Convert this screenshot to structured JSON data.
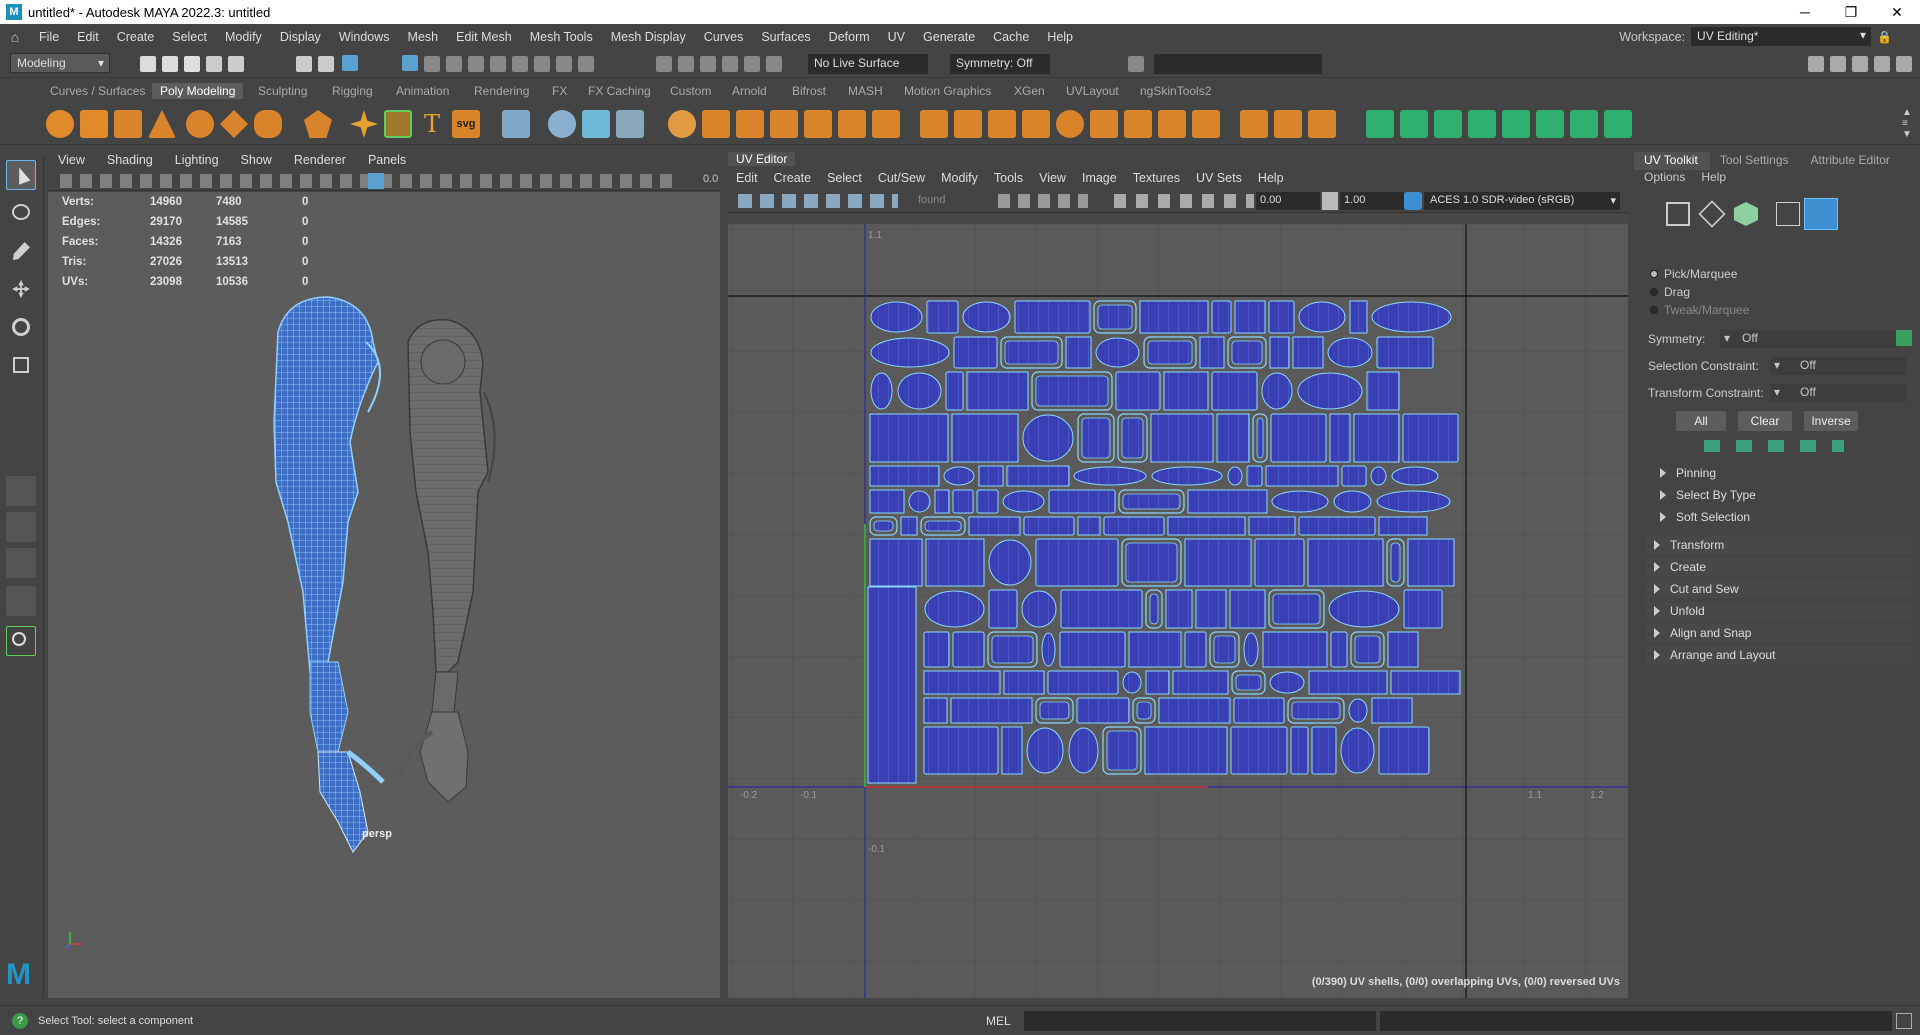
{
  "window": {
    "title": "untitled* - Autodesk MAYA 2022.3: untitled",
    "controls": [
      "─",
      "❐",
      "✕"
    ]
  },
  "menubar": {
    "items": [
      "File",
      "Edit",
      "Create",
      "Select",
      "Modify",
      "Display",
      "Windows",
      "Mesh",
      "Edit Mesh",
      "Mesh Tools",
      "Mesh Display",
      "Curves",
      "Surfaces",
      "Deform",
      "UV",
      "Generate",
      "Cache",
      "Help"
    ],
    "workspace_label": "Workspace:",
    "workspace_value": "UV Editing*"
  },
  "statusline": {
    "mode": "Modeling",
    "live_surface": "No Live Surface",
    "symmetry": "Symmetry: Off"
  },
  "shelf": {
    "tabs": [
      "Curves / Surfaces",
      "Poly Modeling",
      "Sculpting",
      "Rigging",
      "Animation",
      "Rendering",
      "FX",
      "FX Caching",
      "Custom",
      "Arnold",
      "Bifrost",
      "MASH",
      "Motion Graphics",
      "XGen",
      "UVLayout",
      "ngSkinTools2"
    ],
    "active_tab": "Poly Modeling",
    "svg_label": "svg"
  },
  "viewport": {
    "menu": [
      "View",
      "Shading",
      "Lighting",
      "Show",
      "Renderer",
      "Panels"
    ],
    "camera": "persp",
    "hud_value": "0.0",
    "stats": [
      {
        "label": "Verts:",
        "a": "14960",
        "b": "7480",
        "c": "0"
      },
      {
        "label": "Edges:",
        "a": "29170",
        "b": "14585",
        "c": "0"
      },
      {
        "label": "Faces:",
        "a": "14326",
        "b": "7163",
        "c": "0"
      },
      {
        "label": "Tris:",
        "a": "27026",
        "b": "13513",
        "c": "0"
      },
      {
        "label": "UVs:",
        "a": "23098",
        "b": "10536",
        "c": "0"
      }
    ]
  },
  "uv_editor": {
    "title": "UV Editor",
    "menu": [
      "Edit",
      "Create",
      "Select",
      "Cut/Sew",
      "Modify",
      "Tools",
      "View",
      "Image",
      "Textures",
      "UV Sets",
      "Help"
    ],
    "found_label": "found",
    "exposure": "0.00",
    "gamma": "1.00",
    "color_space": "ACES 1.0 SDR-video (sRGB)",
    "axis_labels": {
      "x": [
        "-0.2",
        "-0.1",
        "1.1",
        "1.2"
      ],
      "y": [
        "1.1",
        "-0.1"
      ]
    },
    "status": "(0/390) UV shells, (0/0) overlapping UVs, (0/0) reversed UVs"
  },
  "uv_toolkit": {
    "tabs": [
      "UV Toolkit",
      "Tool Settings",
      "Attribute Editor"
    ],
    "submenu": [
      "Options",
      "Help"
    ],
    "radios": [
      "Pick/Marquee",
      "Drag",
      "Tweak/Marquee"
    ],
    "fields": [
      {
        "label": "Symmetry:",
        "value": "Off"
      },
      {
        "label": "Selection Constraint:",
        "value": "Off"
      },
      {
        "label": "Transform Constraint:",
        "value": "Off"
      }
    ],
    "buttons": [
      "All",
      "Clear",
      "Inverse"
    ],
    "subsections": [
      "Pinning",
      "Select By Type",
      "Soft Selection"
    ],
    "sections": [
      "Transform",
      "Create",
      "Cut and Sew",
      "Unfold",
      "Align and Snap",
      "Arrange and Layout"
    ]
  },
  "helpline": {
    "message": "Select Tool: select a component",
    "mel": "MEL"
  },
  "colors": {
    "uv_fill": "#3a3fb4",
    "uv_edge": "#8ad8ff",
    "arm_wire": "#6fb4ff",
    "grid": "#4b4b4b"
  }
}
